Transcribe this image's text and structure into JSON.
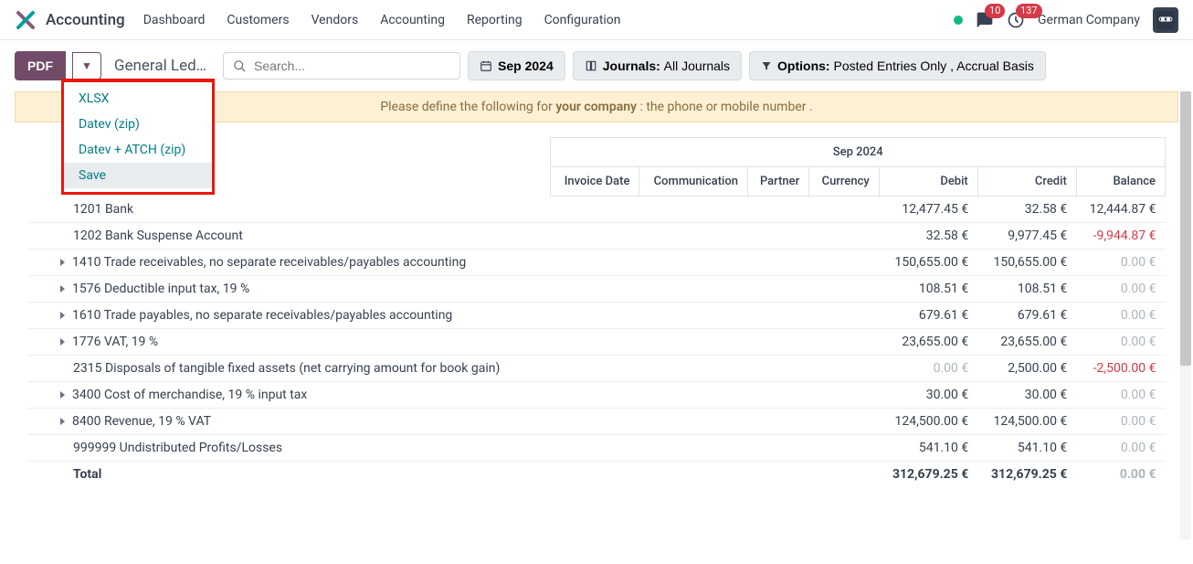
{
  "header": {
    "app_name": "Accounting",
    "nav": [
      "Dashboard",
      "Customers",
      "Vendors",
      "Accounting",
      "Reporting",
      "Configuration"
    ],
    "msg_count": "10",
    "activity_count": "137",
    "company": "German Company"
  },
  "toolbar": {
    "pdf_label": "PDF",
    "breadcrumb": "General Led…",
    "search_placeholder": "Search...",
    "period_label": "Sep 2024",
    "journals_label_a": "Journals: ",
    "journals_label_b": "All Journals",
    "options_label_a": "Options: ",
    "options_label_b": "Posted Entries Only , Accrual Basis"
  },
  "dropdown": {
    "items": [
      "XLSX",
      "Datev (zip)",
      "Datev + ATCH (zip)",
      "Save"
    ]
  },
  "alert": {
    "pre": "Please define the following for ",
    "strong": "your company",
    "post": " : the phone or mobile number ."
  },
  "table": {
    "period": "Sep 2024",
    "cols": [
      "Invoice Date",
      "Communication",
      "Partner",
      "Currency",
      "Debit",
      "Credit",
      "Balance"
    ],
    "rows": [
      {
        "caret": false,
        "acct": "1201 Bank",
        "debit": "12,477.45 €",
        "credit": "32.58 €",
        "balance": "12,444.87 €",
        "bal_neg": false,
        "debit_muted": false
      },
      {
        "caret": false,
        "acct": "1202 Bank Suspense Account",
        "debit": "32.58 €",
        "credit": "9,977.45 €",
        "balance": "-9,944.87 €",
        "bal_neg": true,
        "debit_muted": false
      },
      {
        "caret": true,
        "acct": "1410 Trade receivables, no separate receivables/payables accounting",
        "debit": "150,655.00 €",
        "credit": "150,655.00 €",
        "balance": "0.00 €",
        "bal_neg": false,
        "debit_muted": false,
        "bal_muted": true
      },
      {
        "caret": true,
        "acct": "1576 Deductible input tax, 19 %",
        "debit": "108.51 €",
        "credit": "108.51 €",
        "balance": "0.00 €",
        "bal_neg": false,
        "debit_muted": false,
        "bal_muted": true
      },
      {
        "caret": true,
        "acct": "1610 Trade payables, no separate receivables/payables accounting",
        "debit": "679.61 €",
        "credit": "679.61 €",
        "balance": "0.00 €",
        "bal_neg": false,
        "debit_muted": false,
        "bal_muted": true
      },
      {
        "caret": true,
        "acct": "1776 VAT, 19 %",
        "debit": "23,655.00 €",
        "credit": "23,655.00 €",
        "balance": "0.00 €",
        "bal_neg": false,
        "debit_muted": false,
        "bal_muted": true
      },
      {
        "caret": false,
        "acct": "2315 Disposals of tangible fixed assets (net carrying amount for book gain)",
        "debit": "0.00 €",
        "credit": "2,500.00 €",
        "balance": "-2,500.00 €",
        "bal_neg": true,
        "debit_muted": true
      },
      {
        "caret": true,
        "acct": "3400 Cost of merchandise, 19 % input tax",
        "debit": "30.00 €",
        "credit": "30.00 €",
        "balance": "0.00 €",
        "bal_neg": false,
        "debit_muted": false,
        "bal_muted": true
      },
      {
        "caret": true,
        "acct": "8400 Revenue, 19 % VAT",
        "debit": "124,500.00 €",
        "credit": "124,500.00 €",
        "balance": "0.00 €",
        "bal_neg": false,
        "debit_muted": false,
        "bal_muted": true
      },
      {
        "caret": false,
        "acct": "999999 Undistributed Profits/Losses",
        "debit": "541.10 €",
        "credit": "541.10 €",
        "balance": "0.00 €",
        "bal_neg": false,
        "debit_muted": false,
        "bal_muted": true
      }
    ],
    "total": {
      "label": "Total",
      "debit": "312,679.25 €",
      "credit": "312,679.25 €",
      "balance": "0.00 €"
    }
  }
}
